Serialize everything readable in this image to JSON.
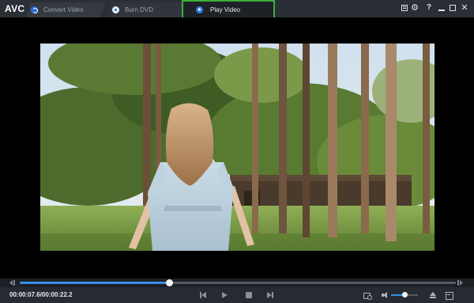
{
  "app": {
    "logo": "AVC"
  },
  "tabs": [
    {
      "label": "Convert Video",
      "icon": "convert-icon",
      "active": false
    },
    {
      "label": "Burn DVD",
      "icon": "disc-icon",
      "active": false
    },
    {
      "label": "Play Video",
      "icon": "play-circle-icon",
      "active": true
    }
  ],
  "window_controls": {
    "list_icon": "task-list-icon",
    "settings_glyph": "⚙",
    "help_glyph": "?",
    "close_glyph": "✕"
  },
  "player": {
    "current_time": "00:00:07.6",
    "duration": "00:00:22.2",
    "timecode": "00:00:07.6/00:00:22.2",
    "progress_fraction": 0.342,
    "volume_fraction": 0.5
  },
  "colors": {
    "accent": "#3a8ee6",
    "highlight_box": "#3db13b",
    "titlebar": "#2a2e35",
    "controlbar": "#262a31"
  }
}
